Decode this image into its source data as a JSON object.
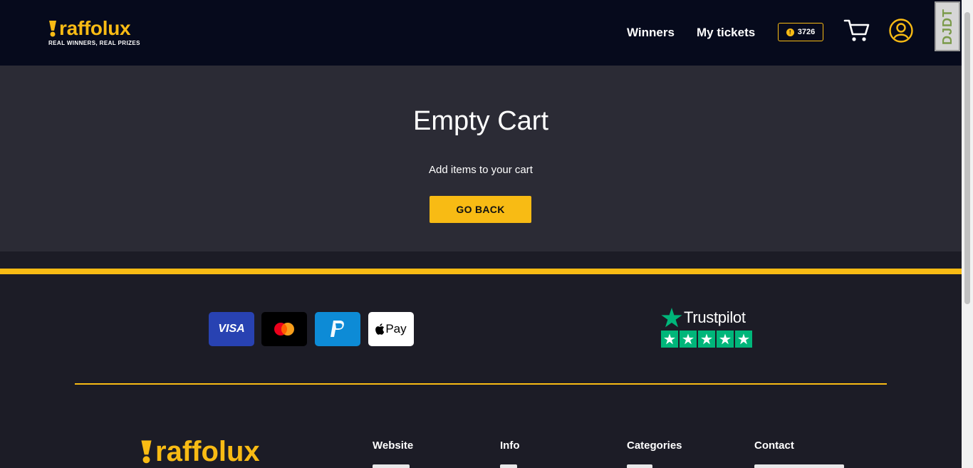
{
  "header": {
    "logo_text": "raffolux",
    "logo_tagline": "REAL WINNERS, REAL PRIZES",
    "nav": {
      "winners": "Winners",
      "my_tickets": "My tickets"
    },
    "points": "3726",
    "cart_icon": "cart-icon",
    "user_icon": "user-icon"
  },
  "debug_toolbar": {
    "label": "DJDT"
  },
  "main": {
    "title": "Empty Cart",
    "subtitle": "Add items to your cart",
    "go_back": "GO BACK"
  },
  "footer": {
    "payments": {
      "visa": "VISA",
      "mastercard": "mastercard-icon",
      "paypal": "paypal-icon",
      "apple_pay": "Pay"
    },
    "trustpilot": "Trustpilot",
    "logo_text": "raffolux",
    "columns": {
      "website": "Website",
      "info": "Info",
      "categories": "Categories",
      "contact": "Contact"
    }
  },
  "colors": {
    "brand_yellow": "#f8bb14",
    "header_bg": "#060a1c",
    "main_bg": "#2b2b35",
    "footer_bg": "#1c1c26",
    "trustpilot_green": "#00b67a"
  }
}
